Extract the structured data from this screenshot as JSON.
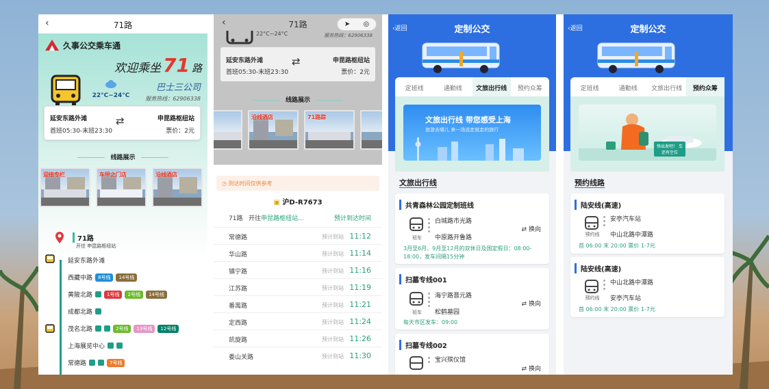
{
  "panel1": {
    "nav_back": "‹",
    "nav_title": "71路",
    "brand": "久事公交乘车通",
    "welcome_text": "欢迎乘坐",
    "route_number": "71",
    "route_suffix": "路",
    "temperature": "22°C~24°C",
    "company": "巴士三公司",
    "hotline": "服务热线：62906338",
    "from_stop": "延安东路外滩",
    "to_stop": "申昆路枢纽站",
    "first_last": "首班05:30-末班23:30",
    "fare": "票价：2元",
    "section_title": "线路展示",
    "photo_captions": [
      "迎接专栏",
      "车甲之门店",
      "沿线酒店"
    ],
    "route_name": "71路",
    "route_direction": "开往 申昆路枢纽站",
    "stops": [
      {
        "name": "延安东路外滩",
        "tags": []
      },
      {
        "name": "西藏中路",
        "tags": [
          {
            "label": "8号线",
            "color": "#1e90d6"
          },
          {
            "label": "14号线",
            "color": "#8a6d3b"
          }
        ]
      },
      {
        "name": "黄陂北路",
        "tags": [
          {
            "label": "1号线",
            "color": "#e0383e"
          },
          {
            "label": "2号线",
            "color": "#6cba2d"
          },
          {
            "label": "14号线",
            "color": "#8a6d3b"
          }
        ]
      },
      {
        "name": "成都北路",
        "tags": []
      },
      {
        "name": "茂名北路",
        "tags": [
          {
            "label": "2号线",
            "color": "#6cba2d"
          },
          {
            "label": "13号线",
            "color": "#e596c6"
          },
          {
            "label": "12号线",
            "color": "#00806a"
          }
        ]
      },
      {
        "name": "上海展览中心",
        "tags": []
      },
      {
        "name": "常德路",
        "tags": [
          {
            "label": "7号线",
            "color": "#ec7b2e"
          }
        ]
      }
    ]
  },
  "panel2": {
    "nav_title": "71路",
    "nav_back": "‹",
    "locate_icon": "➤",
    "target_icon": "◎",
    "temp_partial": "22°C~24°C",
    "hotline_partial": "服务热线：62906338",
    "from_stop": "延安东路外滩",
    "to_stop": "申昆路枢纽站",
    "first_last": "首班05:30-末班23:30",
    "fare": "票价：2元",
    "section_title": "线路展示",
    "photo_captions": [
      "沿线酒店",
      "71路踪"
    ],
    "hint": "到达时间仅供参考",
    "plate": "沪D-R7673",
    "route_label": "71路",
    "toward_prefix": "开往",
    "toward_dest": "申昆路枢纽站...",
    "eta_header": "预计到达时间",
    "arrivals": [
      {
        "stop": "常德路",
        "label": "预计到站",
        "time": "11:12"
      },
      {
        "stop": "华山路",
        "label": "预计到站",
        "time": "11:14"
      },
      {
        "stop": "镇宁路",
        "label": "预计到站",
        "time": "11:16"
      },
      {
        "stop": "江苏路",
        "label": "预计到站",
        "time": "11:19"
      },
      {
        "stop": "番禺路",
        "label": "预计到站",
        "time": "11:21"
      },
      {
        "stop": "定西路",
        "label": "预计到站",
        "time": "11:24"
      },
      {
        "stop": "凯旋路",
        "label": "预计到站",
        "time": "11:26"
      },
      {
        "stop": "娄山关路",
        "label": "预计到站",
        "time": "11:30"
      }
    ]
  },
  "panel3": {
    "nav_back": "‹返回",
    "nav_title": "定制公交",
    "tabs": [
      "定班线",
      "通勤线",
      "文旅出行线",
      "预约众筹"
    ],
    "active_tab": "文旅出行线",
    "banner_title": "文旅出行线 带您感受上海",
    "banner_sub": "旅游去哪儿 来一场说走就走的旅行",
    "section": "文旅出行线",
    "routes": [
      {
        "title": "共青森林公园定制班线",
        "icon_label": "班车",
        "from": "白城路市光路",
        "to": "中原路开鲁路",
        "transfer": "换向",
        "note": "3月至6月、9月至12月的双休日及国定假日：08:00-18:00，发车间隔15分钟"
      },
      {
        "title": "扫墓专线001",
        "icon_label": "班车",
        "from": "海宁路晋元路",
        "to": "松鹤墓园",
        "transfer": "换向",
        "note": "每天市区发车：09:00"
      },
      {
        "title": "扫墓专线002",
        "icon_label": "",
        "from": "宝兴殡仪馆",
        "to": "",
        "transfer": "换向",
        "note": ""
      }
    ]
  },
  "panel4": {
    "nav_back": "‹返回",
    "nav_title": "定制公交",
    "tabs": [
      "定班线",
      "通勤线",
      "文旅出行线",
      "预约众筹"
    ],
    "active_tab": "预约众筹",
    "banner_badge": "快出发吧！ 车还有空位",
    "section": "预约线路",
    "routes": [
      {
        "title": "陆安线(高速)",
        "icon_label": "预约线",
        "from": "安亭汽车站",
        "to": "中山北路中潭路",
        "note": "首 06:00  末 20:00  票价 1-7元"
      },
      {
        "title": "陆安线(高速)",
        "icon_label": "预约线",
        "from": "中山北路中潭路",
        "to": "安亭汽车站",
        "note": "首 06:00  末 20:00  票价 1-7元"
      }
    ]
  },
  "colors": {
    "teal": "#1f9d87",
    "blue": "#2d6fe0",
    "red": "#e03a2f"
  }
}
